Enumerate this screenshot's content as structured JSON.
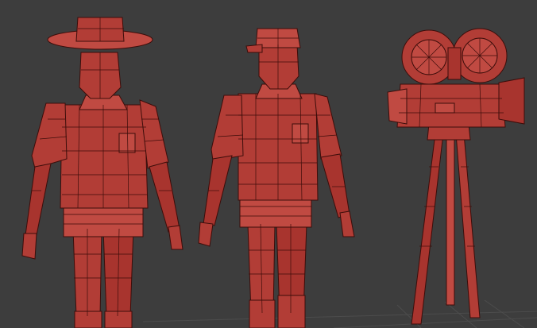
{
  "viewport": {
    "background": "#3d3d3d",
    "mesh_color": "#b23d36",
    "wire_color": "#3c0d0a",
    "grid_color": "#4c4c4c"
  },
  "models": [
    {
      "name": "cowboy-hat-figure",
      "icon": "figure-with-brimmed-hat"
    },
    {
      "name": "cap-figure",
      "icon": "figure-with-cap"
    },
    {
      "name": "film-camera",
      "icon": "vintage-movie-camera-on-tripod"
    }
  ]
}
